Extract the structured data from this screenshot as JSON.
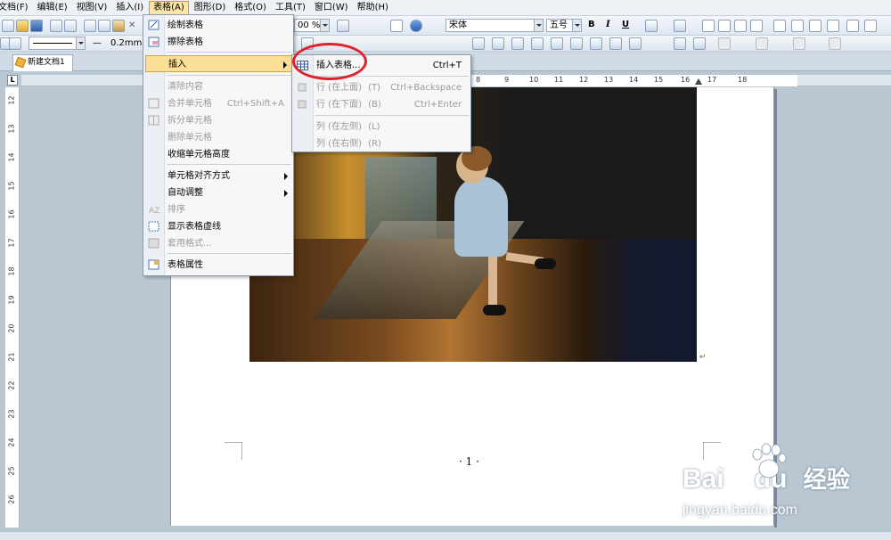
{
  "menubar": {
    "items": [
      "文档(F)",
      "编辑(E)",
      "视图(V)",
      "插入(I)",
      "表格(A)",
      "图形(D)",
      "格式(O)",
      "工具(T)",
      "窗口(W)",
      "帮助(H)"
    ]
  },
  "toolbar": {
    "zoom": "00 %",
    "font_name": "宋体",
    "font_size": "五号",
    "bold": "B",
    "italic": "I",
    "underline": "U",
    "line_width": "0.2mm"
  },
  "tabs": {
    "doc_tab": "新建文档1"
  },
  "ruler": {
    "corner": "L",
    "h_numbers": [
      "8",
      "9",
      "10",
      "11",
      "12",
      "13",
      "14",
      "15",
      "16",
      "17",
      "18"
    ],
    "v_numbers": [
      "12",
      "13",
      "14",
      "15",
      "16",
      "17",
      "18",
      "19",
      "20",
      "21",
      "22",
      "23",
      "24",
      "25",
      "26"
    ]
  },
  "table_menu": {
    "items": [
      {
        "label": "绘制表格",
        "icon": "draw-table-icon"
      },
      {
        "label": "擦除表格",
        "icon": "erase-table-icon"
      },
      {
        "label": "插入",
        "submenu": true,
        "highlighted": true
      },
      {
        "label": "清除内容",
        "disabled": true
      },
      {
        "label": "合并单元格",
        "shortcut": "Ctrl+Shift+A",
        "disabled": true,
        "icon": "merge-cells-icon"
      },
      {
        "label": "拆分单元格",
        "disabled": true,
        "icon": "split-cells-icon"
      },
      {
        "label": "删除单元格",
        "disabled": true
      },
      {
        "label": "收缩单元格高度"
      },
      {
        "label": "单元格对齐方式",
        "submenu": true
      },
      {
        "label": "自动调整",
        "submenu": true
      },
      {
        "label": "排序",
        "disabled": true,
        "icon": "sort-icon"
      },
      {
        "label": "显示表格虚线",
        "icon": "table-gridlines-icon"
      },
      {
        "label": "套用格式...",
        "disabled": true,
        "icon": "table-format-icon"
      },
      {
        "label": "表格属性",
        "icon": "table-properties-icon"
      }
    ]
  },
  "insert_submenu": {
    "items": [
      {
        "label": "插入表格...",
        "shortcut": "Ctrl+T",
        "icon": "insert-table-icon"
      },
      {
        "label": "行 (在上面)",
        "accel": "(T)",
        "shortcut": "Ctrl+Backspace",
        "disabled": true
      },
      {
        "label": "行 (在下面)",
        "accel": "(B)",
        "shortcut": "Ctrl+Enter",
        "disabled": true
      },
      {
        "label": "列 (在左侧)",
        "accel": "(L)",
        "disabled": true
      },
      {
        "label": "列 (在右侧)",
        "accel": "(R)",
        "disabled": true
      }
    ]
  },
  "document": {
    "page_number": "· 1 ·",
    "para_mark": "↵"
  },
  "watermark": {
    "brand_left": "Bai",
    "brand_right": "du",
    "brand_cn": "经验",
    "url": "jingyan.baidu.com"
  },
  "colors": {
    "highlight": "#fbdf96",
    "annotation": "#e0232a",
    "workspace": "#b9c7d3"
  }
}
